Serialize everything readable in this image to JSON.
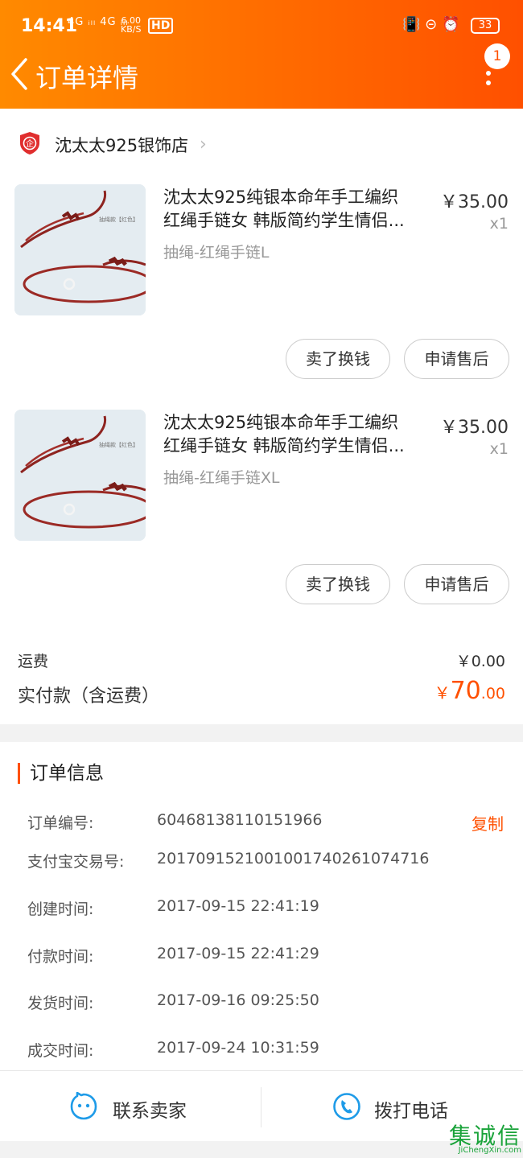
{
  "status_bar": {
    "time": "14:41",
    "network": "4G ᵢₗₗ 4G ᵢₗₗ",
    "speed_value": "6.00",
    "speed_unit": "KB/S",
    "hd": "HD",
    "icons": "📳 ⊝ ⏰",
    "battery": "33"
  },
  "header": {
    "title": "订单详情",
    "more_badge": "1",
    "back_icon": "chevron-left-icon",
    "more_icon": "more-vertical-icon",
    "accent": "#ff5000"
  },
  "shop": {
    "name": "沈太太925银饰店",
    "arrow": "›",
    "badge_text": "企"
  },
  "items": [
    {
      "title_line1": "沈太太925纯银本命年手工编织",
      "title_line2": "红绳手链女 韩版简约学生情侣...",
      "spec": "抽绳-红绳手链L",
      "price": "￥35.00",
      "qty": "x1",
      "thumb_label": "抽绳款【红色】",
      "sell_btn": "卖了换钱",
      "after_btn": "申请售后"
    },
    {
      "title_line1": "沈太太925纯银本命年手工编织",
      "title_line2": "红绳手链女 韩版简约学生情侣...",
      "spec": "抽绳-红绳手链XL",
      "price": "￥35.00",
      "qty": "x1",
      "thumb_label": "抽绳款【红色】",
      "sell_btn": "卖了换钱",
      "after_btn": "申请售后"
    }
  ],
  "summary": {
    "shipping_label": "运费",
    "shipping_value": "￥0.00",
    "paid_label": "实付款（含运费）",
    "paid_currency": "￥",
    "paid_int": "70",
    "paid_dec": ".00"
  },
  "order_info": {
    "title": "订单信息",
    "copy_label": "复制",
    "rows": [
      {
        "key": "订单编号:",
        "value": "60468138110151966"
      },
      {
        "key": "支付宝交易号:",
        "value": "2017091521001001740261074716"
      },
      {
        "key": "创建时间:",
        "value": "2017-09-15 22:41:19"
      },
      {
        "key": "付款时间:",
        "value": "2017-09-15 22:41:29"
      },
      {
        "key": "发货时间:",
        "value": "2017-09-16 09:25:50"
      },
      {
        "key": "成交时间:",
        "value": "2017-09-24 10:31:59"
      }
    ]
  },
  "bottom_bar": {
    "contact_label": "联系卖家",
    "phone_label": "拨打电话",
    "contact_icon": "chat-face-icon",
    "phone_icon": "phone-icon",
    "icon_color": "#1e9be8"
  },
  "watermark": {
    "glyphs": "集诚信",
    "url": "JiChengXin.com"
  }
}
